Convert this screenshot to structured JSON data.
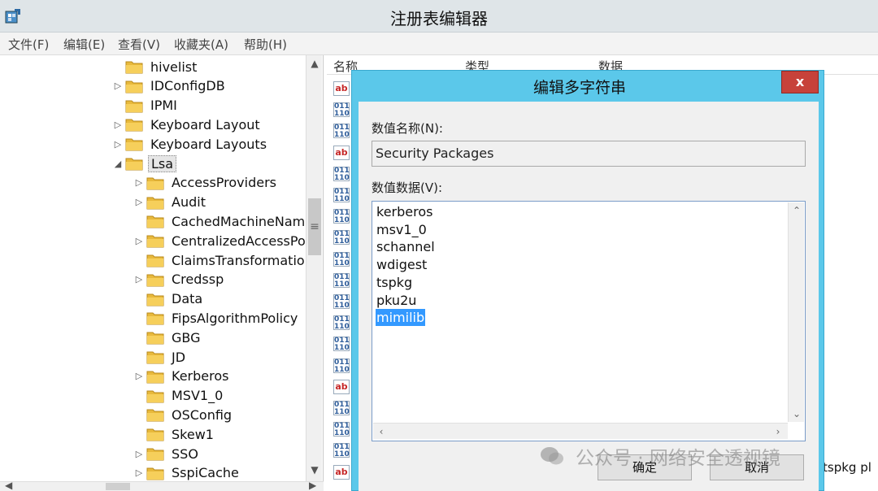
{
  "window": {
    "title": "注册表编辑器"
  },
  "menu": [
    "文件(F)",
    "编辑(E)",
    "查看(V)",
    "收藏夹(A)",
    "帮助(H)"
  ],
  "tree": [
    {
      "label": "hivelist",
      "arrow": ""
    },
    {
      "label": "IDConfigDB",
      "arrow": "▷"
    },
    {
      "label": "IPMI",
      "arrow": ""
    },
    {
      "label": "Keyboard Layout",
      "arrow": "▷"
    },
    {
      "label": "Keyboard Layouts",
      "arrow": "▷"
    },
    {
      "label": "Lsa",
      "arrow": "◢"
    },
    {
      "label": "AccessProviders",
      "arrow": "▷"
    },
    {
      "label": "Audit",
      "arrow": "▷"
    },
    {
      "label": "CachedMachineName",
      "arrow": ""
    },
    {
      "label": "CentralizedAccessPo",
      "arrow": "▷"
    },
    {
      "label": "ClaimsTransformation",
      "arrow": ""
    },
    {
      "label": "Credssp",
      "arrow": "▷"
    },
    {
      "label": "Data",
      "arrow": ""
    },
    {
      "label": "FipsAlgorithmPolicy",
      "arrow": ""
    },
    {
      "label": "GBG",
      "arrow": ""
    },
    {
      "label": "JD",
      "arrow": ""
    },
    {
      "label": "Kerberos",
      "arrow": "▷"
    },
    {
      "label": "MSV1_0",
      "arrow": ""
    },
    {
      "label": "OSConfig",
      "arrow": ""
    },
    {
      "label": "Skew1",
      "arrow": ""
    },
    {
      "label": "SSO",
      "arrow": "▷"
    },
    {
      "label": "SspiCache",
      "arrow": "▷"
    }
  ],
  "list": {
    "columns": [
      "名称",
      "类型",
      "数据"
    ],
    "icons": [
      "ab",
      "bin",
      "bin",
      "ab",
      "bin",
      "bin",
      "bin",
      "bin",
      "bin",
      "bin",
      "bin",
      "bin",
      "bin",
      "bin",
      "ab",
      "bin",
      "bin",
      "bin",
      "ab"
    ],
    "tail_text": "tspkg pl"
  },
  "dialog": {
    "title": "编辑多字符串",
    "close": "x",
    "name_label": "数值名称(N):",
    "name_value": "Security Packages",
    "data_label": "数值数据(V):",
    "data_lines": [
      "kerberos",
      "msv1_0",
      "schannel",
      "wdigest",
      "tspkg",
      "pku2u",
      "mimilib"
    ],
    "selected_line": "mimilib",
    "ok": "确定",
    "cancel": "取消"
  },
  "watermark": "公众号 · 网络安全透视镜"
}
